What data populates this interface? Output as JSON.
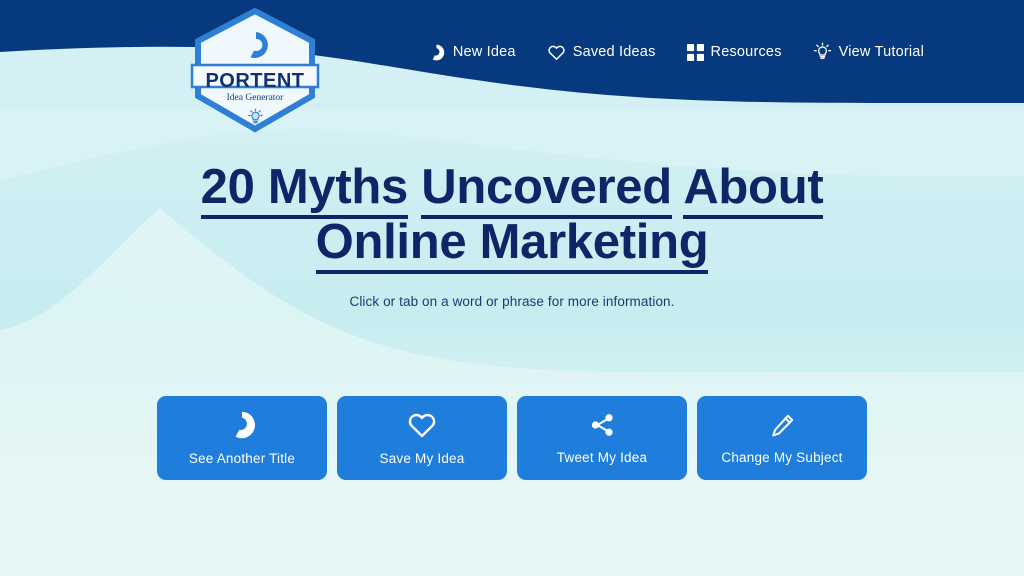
{
  "brand": {
    "logo_name": "PORTENT",
    "logo_tagline": "Idea Generator",
    "logo_mark_icon": "portent-ring-icon",
    "logo_bulb_icon": "lightbulb-icon"
  },
  "colors": {
    "header_navy": "#06397d",
    "headline_navy": "#102468",
    "button_blue": "#1f7ddb",
    "background_cyan": "#c7edf1",
    "background_mint": "#e8f7f2",
    "logo_blue": "#2f7fd4",
    "white": "#ffffff"
  },
  "nav": {
    "items": [
      {
        "label": "New Idea",
        "icon": "refresh-ring-icon"
      },
      {
        "label": "Saved Ideas",
        "icon": "heart-icon"
      },
      {
        "label": "Resources",
        "icon": "grid-icon"
      },
      {
        "label": "View Tutorial",
        "icon": "lightbulb-rays-icon"
      }
    ]
  },
  "main": {
    "headline_phrases": [
      "20 Myths",
      "Uncovered",
      "About Online Marketing"
    ],
    "headline_full": "20 Myths Uncovered About Online Marketing",
    "subtitle": "Click or tab on a word or phrase for more information."
  },
  "actions": {
    "buttons": [
      {
        "label": "See Another Title",
        "icon": "refresh-ring-icon"
      },
      {
        "label": "Save My Idea",
        "icon": "heart-icon"
      },
      {
        "label": "Tweet My Idea",
        "icon": "share-icon"
      },
      {
        "label": "Change My Subject",
        "icon": "pencil-icon"
      }
    ]
  }
}
